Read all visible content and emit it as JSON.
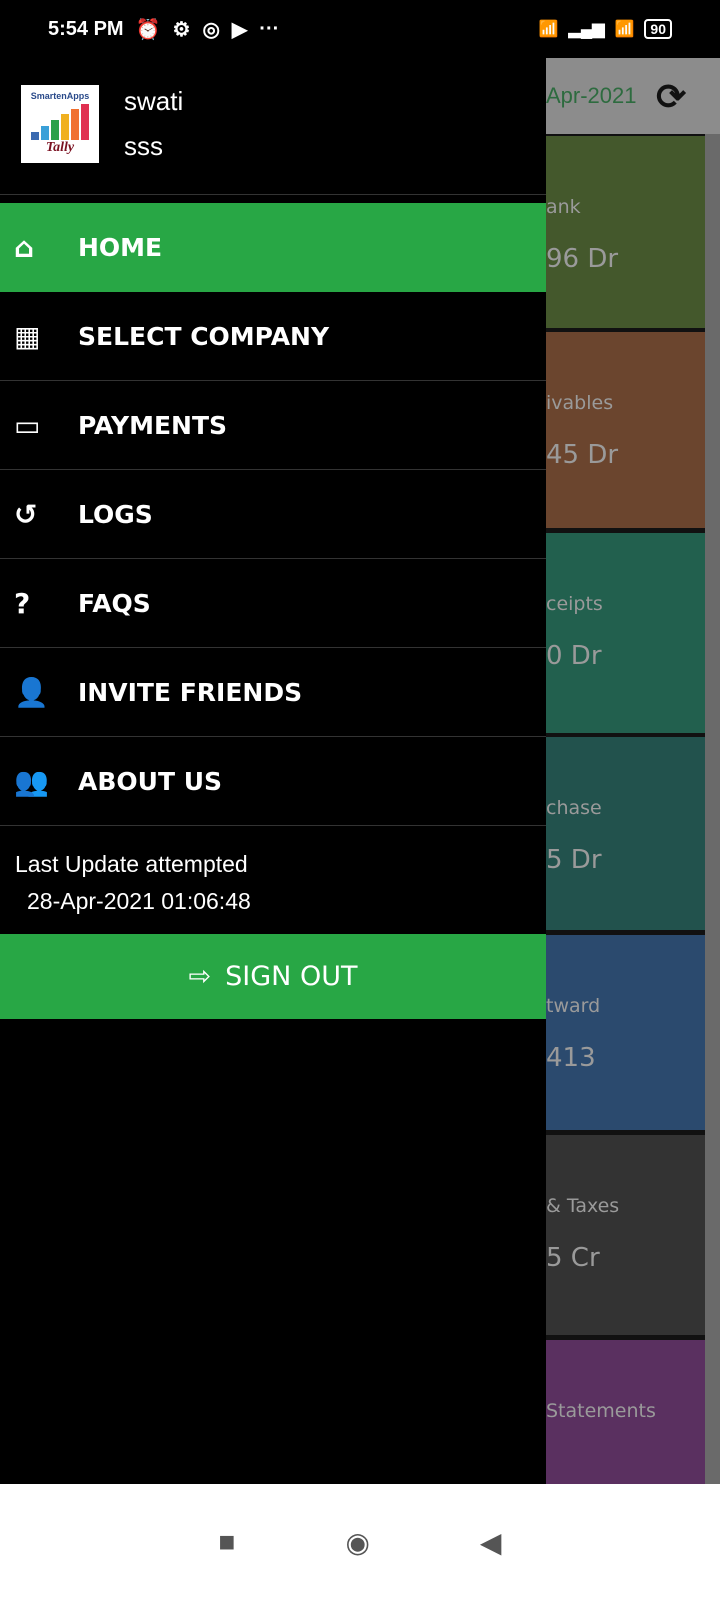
{
  "status_bar": {
    "time": "5:54 PM",
    "battery": "90"
  },
  "background": {
    "date": "Apr-2021",
    "tiles": [
      {
        "label": "ank",
        "value": "96 Dr",
        "color": "#44582c"
      },
      {
        "label": "ivables",
        "value": "45 Dr",
        "color": "#6b452e"
      },
      {
        "label": "ceipts",
        "value": "0 Dr",
        "color": "#22604e"
      },
      {
        "label": "chase",
        "value": "5 Dr",
        "color": "#22524d"
      },
      {
        "label": "tward",
        "value": "413",
        "color": "#2b4a6e"
      },
      {
        "label": "& Taxes",
        "value": "5 Cr",
        "color": "#333333"
      },
      {
        "label": "Statements",
        "value": "",
        "color": "#5a3060"
      }
    ]
  },
  "drawer": {
    "logo_text": "SmartenApps",
    "logo_sub": "Tally",
    "user": "swati",
    "company": "sss",
    "items": [
      {
        "label": "HOME",
        "icon": "home-icon"
      },
      {
        "label": "SELECT COMPANY",
        "icon": "building-icon"
      },
      {
        "label": "PAYMENTS",
        "icon": "money-icon"
      },
      {
        "label": "LOGS",
        "icon": "history-icon"
      },
      {
        "label": "FAQS",
        "icon": "question-icon"
      },
      {
        "label": "INVITE FRIENDS",
        "icon": "user-plus-icon"
      },
      {
        "label": "ABOUT US",
        "icon": "users-icon"
      }
    ],
    "last_update_label": "Last Update attempted",
    "last_update_value": "28-Apr-2021 01:06:48",
    "sign_out": "SIGN OUT"
  },
  "accent": "#28a745"
}
